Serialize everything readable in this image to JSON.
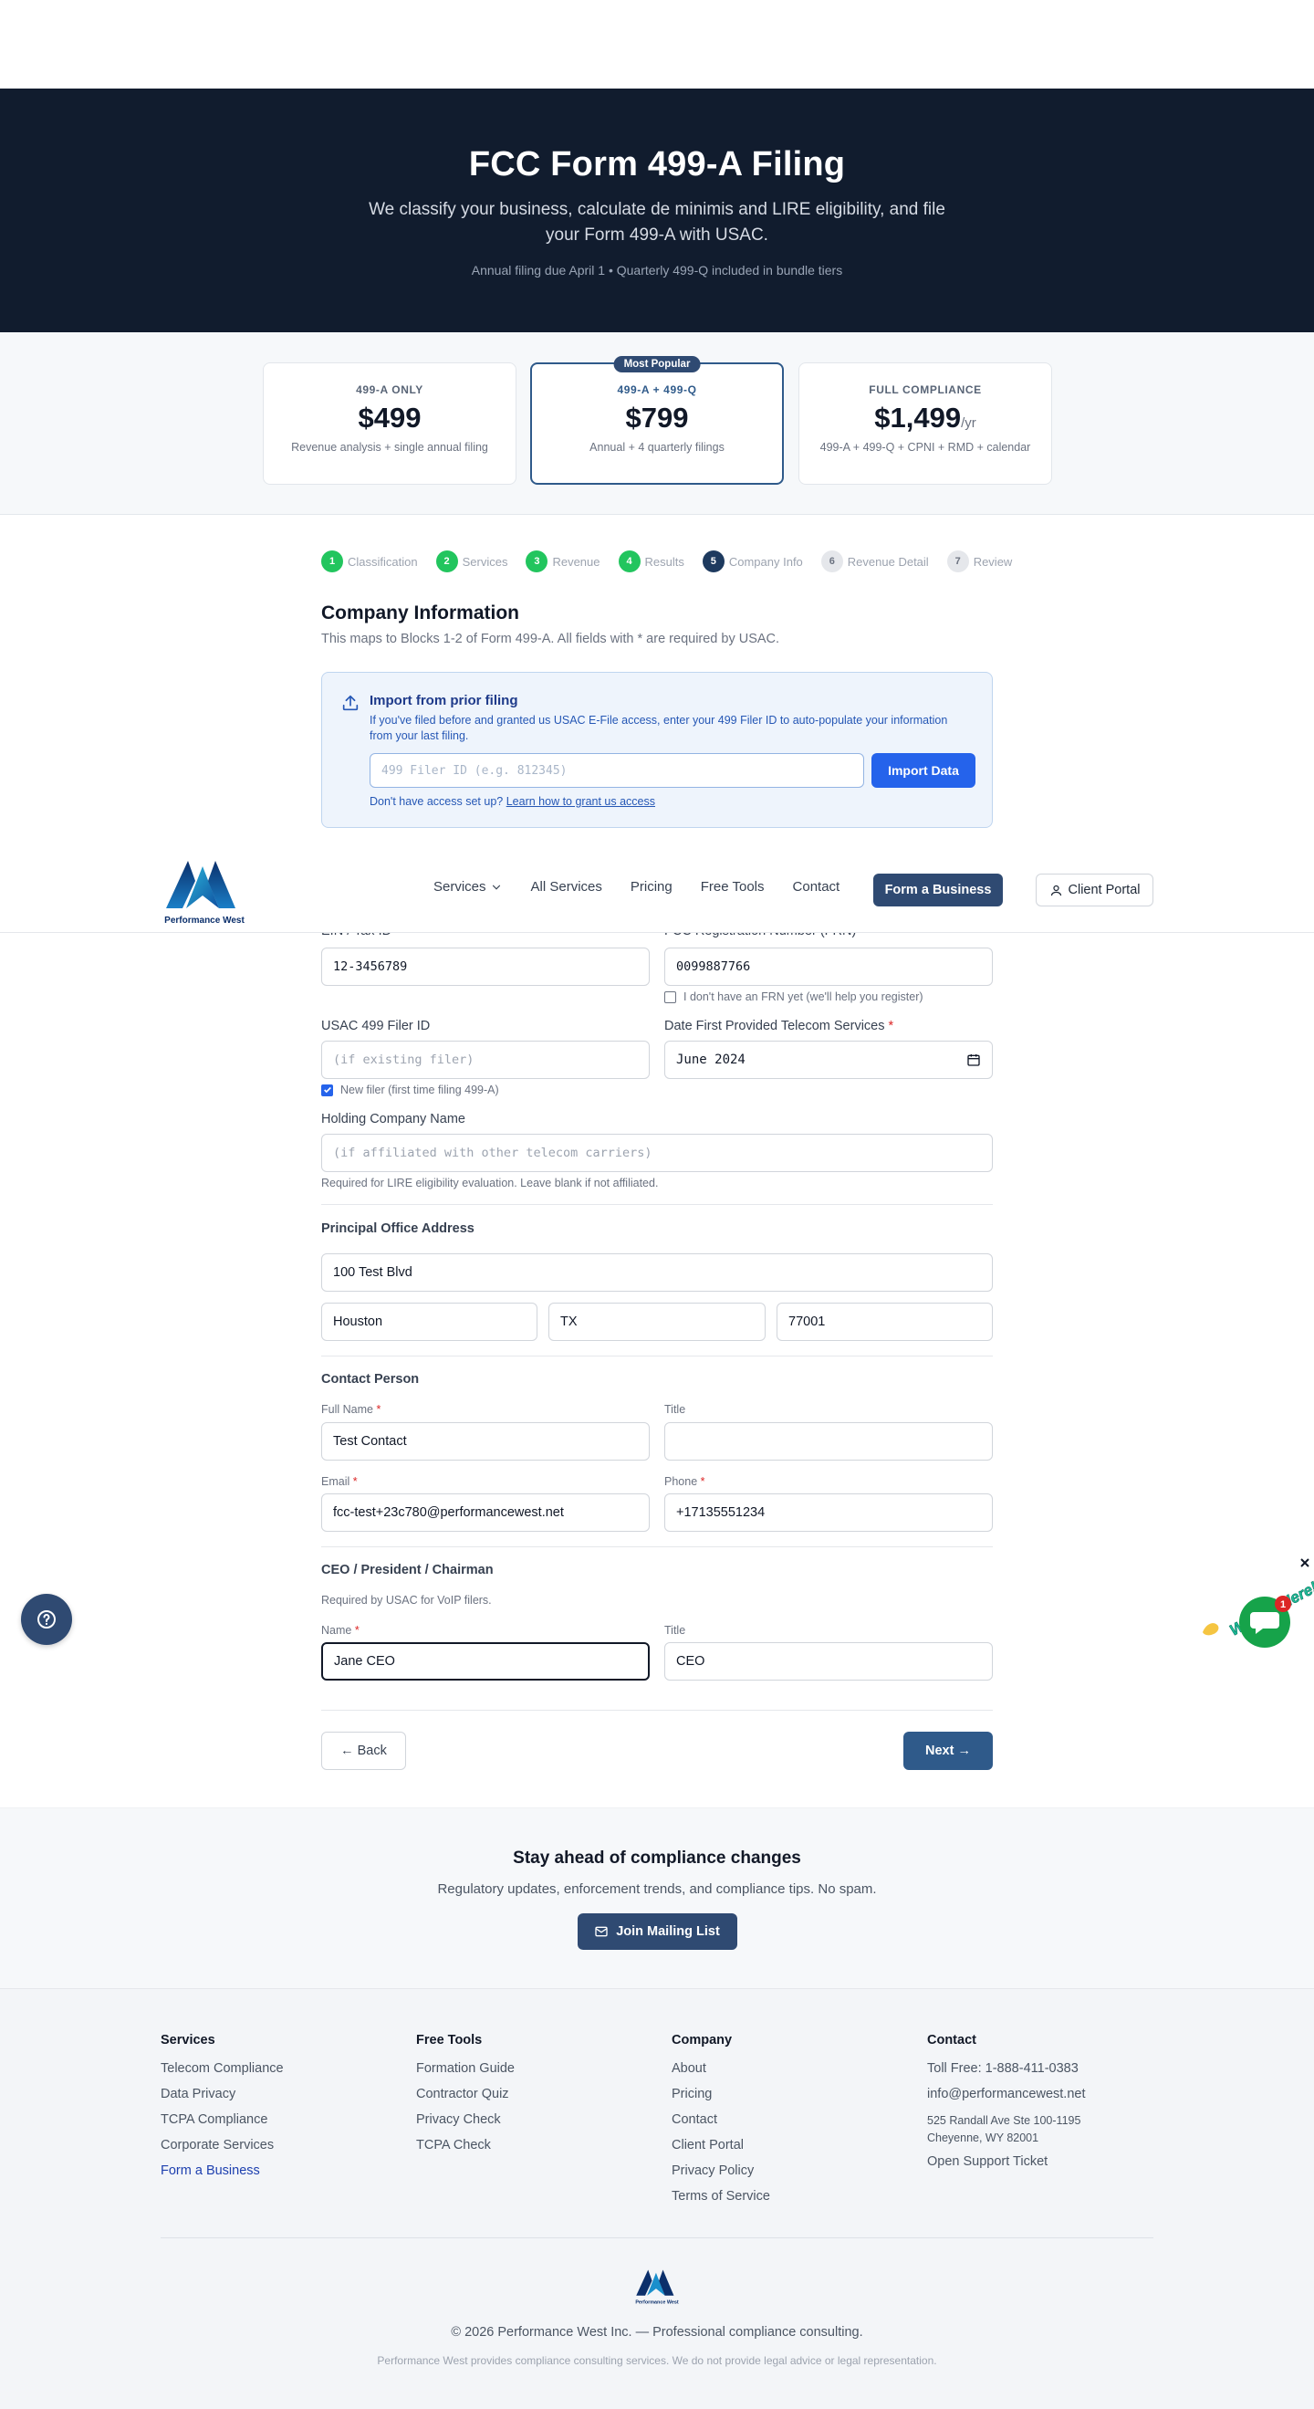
{
  "hero": {
    "title": "FCC Form 499-A Filing",
    "subtitle": "We classify your business, calculate de minimis and LIRE eligibility, and file your Form 499-A with USAC.",
    "note": "Annual filing due April 1 • Quarterly 499-Q included in bundle tiers"
  },
  "pricing": [
    {
      "tier": "499-A ONLY",
      "price": "$499",
      "per": "",
      "desc": "Revenue analysis + single annual filing",
      "badge": ""
    },
    {
      "tier": "499-A + 499-Q",
      "price": "$799",
      "per": "",
      "desc": "Annual + 4 quarterly filings",
      "badge": "Most Popular"
    },
    {
      "tier": "FULL COMPLIANCE",
      "price": "$1,499",
      "per": "/yr",
      "desc": "499-A + 499-Q + CPNI + RMD + calendar",
      "badge": ""
    }
  ],
  "steps": [
    {
      "num": "1",
      "label": "Classification",
      "state": "done"
    },
    {
      "num": "2",
      "label": "Services",
      "state": "done"
    },
    {
      "num": "3",
      "label": "Revenue",
      "state": "done"
    },
    {
      "num": "4",
      "label": "Results",
      "state": "done"
    },
    {
      "num": "5",
      "label": "Company Info",
      "state": "current"
    },
    {
      "num": "6",
      "label": "Revenue Detail",
      "state": "future"
    },
    {
      "num": "7",
      "label": "Review",
      "state": "future"
    }
  ],
  "section": {
    "title": "Company Information",
    "subtitle": "This maps to Blocks 1-2 of Form 499-A. All fields with * are required by USAC."
  },
  "import": {
    "title": "Import from prior filing",
    "desc": "If you've filed before and granted us USAC E-File access, enter your 499 Filer ID to auto-populate your information from your last filing.",
    "placeholder": "499 Filer ID (e.g. 812345)",
    "button": "Import Data",
    "help_prefix": "Don't have access set up?",
    "help_link": "Learn how to grant us access"
  },
  "nav": {
    "logo_text": "Performance West",
    "links": [
      "Services",
      "All Services",
      "Pricing",
      "Free Tools",
      "Contact"
    ],
    "cta": "Form a Business",
    "portal": "Client Portal"
  },
  "form": {
    "ein_label": "EIN / Tax ID",
    "ein_value": "12-3456789",
    "frn_label": "FCC Registration Number (FRN)",
    "frn_value": "0099887766",
    "frn_check": "I don't have an FRN yet (we'll help you register)",
    "filer_label": "USAC 499 Filer ID",
    "filer_placeholder": "(if existing filer)",
    "filer_check": "New filer (first time filing 499-A)",
    "date_label": "Date First Provided Telecom Services",
    "date_value": "June 2024",
    "holding_label": "Holding Company Name",
    "holding_placeholder": "(if affiliated with other telecom carriers)",
    "holding_hint": "Required for LIRE eligibility evaluation. Leave blank if not affiliated.",
    "address_head": "Principal Office Address",
    "street": "100 Test Blvd",
    "city": "Houston",
    "state": "TX",
    "zip": "77001",
    "contact_head": "Contact Person",
    "full_name_label": "Full Name",
    "full_name": "Test Contact",
    "title_label": "Title",
    "contact_title": "",
    "email_label": "Email",
    "email": "fcc-test+23c780@performancewest.net",
    "phone_label": "Phone",
    "phone": "+17135551234",
    "ceo_head": "CEO / President / Chairman",
    "ceo_hint": "Required by USAC for VoIP filers.",
    "name_label": "Name",
    "ceo_name": "Jane CEO",
    "ceo_title_label": "Title",
    "ceo_title": "CEO",
    "back": "← Back",
    "next": "Next →"
  },
  "chat": {
    "badge": "1",
    "text": "We Are Here!"
  },
  "newsletter": {
    "title": "Stay ahead of compliance changes",
    "subtitle": "Regulatory updates, enforcement trends, and compliance tips. No spam.",
    "button": "Join Mailing List"
  },
  "footer": {
    "services": {
      "head": "Services",
      "items": [
        "Telecom Compliance",
        "Data Privacy",
        "TCPA Compliance",
        "Corporate Services",
        "Form a Business"
      ]
    },
    "tools": {
      "head": "Free Tools",
      "items": [
        "Formation Guide",
        "Contractor Quiz",
        "Privacy Check",
        "TCPA Check"
      ]
    },
    "company": {
      "head": "Company",
      "items": [
        "About",
        "Pricing",
        "Contact",
        "Client Portal",
        "Privacy Policy",
        "Terms of Service"
      ]
    },
    "contact": {
      "head": "Contact",
      "phone": "Toll Free: 1-888-411-0383",
      "email": "info@performancewest.net",
      "addr1": "525 Randall Ave Ste 100-1195",
      "addr2": "Cheyenne, WY 82001",
      "ticket": "Open Support Ticket"
    },
    "logo_text": "Performance West",
    "copyright": "© 2026 Performance West Inc. — Professional compliance consulting.",
    "disclaimer": "Performance West provides compliance consulting services. We do not provide legal advice or legal representation."
  },
  "colors": {
    "navy": "#111c2e",
    "accent": "#2f4a72",
    "success": "#22c55e",
    "link": "#2563eb"
  }
}
